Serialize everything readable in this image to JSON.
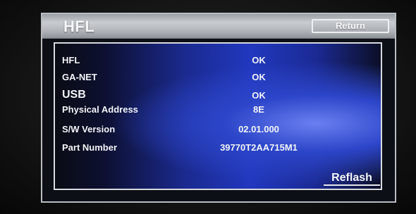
{
  "header": {
    "title": "HFL",
    "return_label": "Return"
  },
  "status_rows": [
    {
      "label": "HFL",
      "value": "OK"
    },
    {
      "label": "GA-NET",
      "value": "OK"
    },
    {
      "label": "USB",
      "value": "OK"
    },
    {
      "label": "Physical Address",
      "value": "8E"
    },
    {
      "label": "S/W Version",
      "value": "02.01.000"
    },
    {
      "label": "Part Number",
      "value": "39770T2AA715M1"
    }
  ],
  "actions": {
    "reflash_label": "Reflash"
  },
  "colors": {
    "title_bar": "#b1b5ba",
    "panel_blue": "#2138bf",
    "text": "#f2f4f7"
  }
}
